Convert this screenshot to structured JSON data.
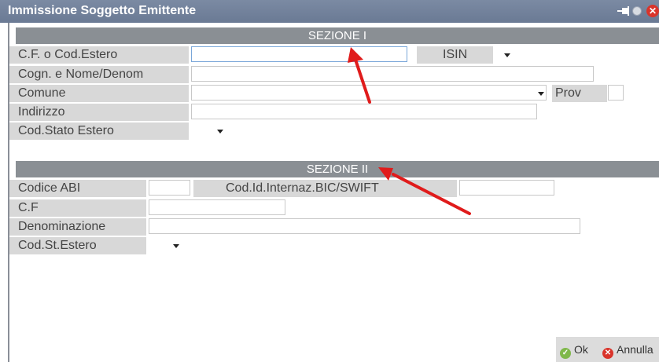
{
  "window": {
    "title": "Immissione Soggetto Emittente"
  },
  "sezione1": {
    "header": "SEZIONE I",
    "cf_label": "C.F. o Cod.Estero",
    "isin_label": "ISIN",
    "cognome_label": "Cogn. e Nome/Denom",
    "comune_label": "Comune",
    "prov_label": "Prov",
    "indirizzo_label": "Indirizzo",
    "stato_label": "Cod.Stato Estero"
  },
  "sezione2": {
    "header": "SEZIONE II",
    "abi_label": "Codice ABI",
    "bic_label": "Cod.Id.Internaz.BIC/SWIFT",
    "cf_label": "C.F",
    "denominazione_label": "Denominazione",
    "stato_label": "Cod.St.Estero"
  },
  "footer": {
    "ok_label": "Ok",
    "annulla_label": "Annulla"
  },
  "icons": {
    "pin": "pin-icon",
    "dot": "circle-icon",
    "close": "close-icon",
    "ok": "check-icon",
    "cancel": "x-icon"
  },
  "colors": {
    "titlebar": "#6f7e97",
    "section_header": "#8a8f94",
    "label_bg": "#d8d8d8",
    "arrow": "#e01b1b"
  }
}
